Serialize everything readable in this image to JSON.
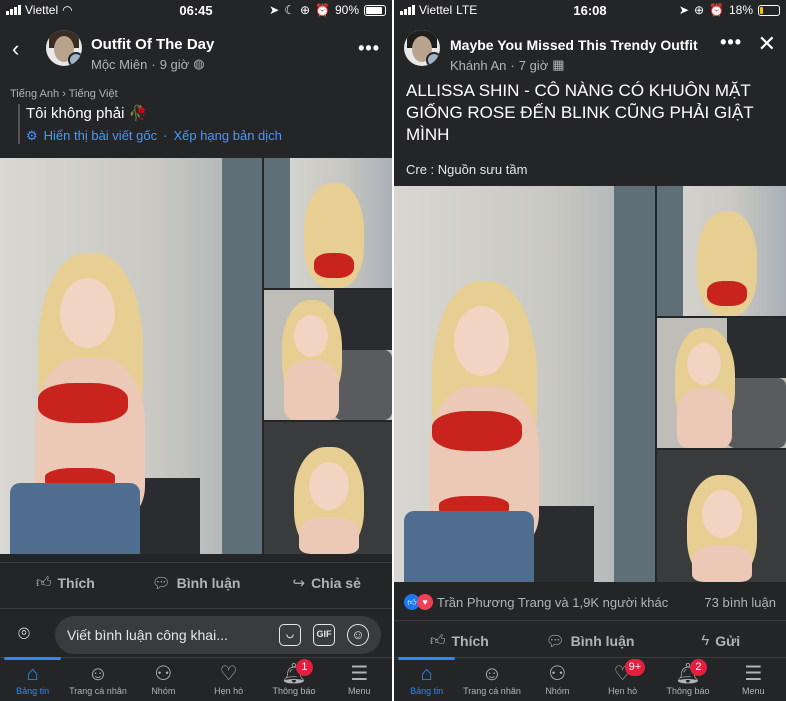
{
  "left": {
    "status": {
      "carrier": "Viettel",
      "time": "06:45",
      "battery": "90%",
      "battery_level": 0.9
    },
    "header": {
      "page_name": "Outfit Of The Day",
      "author": "Mộc Miên",
      "time": "9 giờ"
    },
    "translation": {
      "from": "Tiếng Anh",
      "arrow": "›",
      "to": "Tiếng Việt",
      "text": "Tôi không phải 🥀",
      "show_original": "Hiển thị bài viết gốc",
      "separator": "·",
      "rate": "Xếp hạng bản dịch"
    },
    "actions": {
      "like": "Thích",
      "comment": "Bình luận",
      "share": "Chia sẻ"
    },
    "comment_bar": {
      "placeholder": "Viết bình luận công khai...",
      "gif": "GIF"
    },
    "tabs": [
      {
        "label": "Bảng tin",
        "icon": "home-icon"
      },
      {
        "label": "Trang cá nhân",
        "icon": "profile-icon"
      },
      {
        "label": "Nhóm",
        "icon": "groups-icon"
      },
      {
        "label": "Hẹn hò",
        "icon": "dating-heart-icon"
      },
      {
        "label": "Thông báo",
        "icon": "bell-icon",
        "badge": "1"
      },
      {
        "label": "Menu",
        "icon": "menu-icon"
      }
    ]
  },
  "right": {
    "status": {
      "carrier": "Viettel",
      "network": "LTE",
      "time": "16:08",
      "battery": "18%",
      "battery_level": 0.18
    },
    "header": {
      "page_name": "Maybe You Missed This Trendy Outfit",
      "author": "Khánh An",
      "time": "7 giờ"
    },
    "post": {
      "headline": "ALLISSA SHIN - CÔ NÀNG CÓ KHUÔN MẶT GIỐNG ROSE ĐẾN BLINK CŨNG PHẢI GIẬT MÌNH",
      "source": "Cre : Nguồn sưu tầm"
    },
    "reactions": {
      "summary": "Trần Phương Trang và 1,9K người khác",
      "comments": "73 bình luận"
    },
    "actions": {
      "like": "Thích",
      "comment": "Bình luận",
      "send": "Gửi"
    },
    "tabs": [
      {
        "label": "Bảng tin",
        "icon": "home-icon"
      },
      {
        "label": "Trang cá nhân",
        "icon": "profile-icon"
      },
      {
        "label": "Nhóm",
        "icon": "groups-icon"
      },
      {
        "label": "Hẹn hò",
        "icon": "dating-heart-icon",
        "badge": "9+"
      },
      {
        "label": "Thông báo",
        "icon": "bell-icon",
        "badge": "2"
      },
      {
        "label": "Menu",
        "icon": "menu-icon"
      }
    ]
  },
  "colors": {
    "background": "#242526",
    "accent": "#2d88ff",
    "link": "#4599ff",
    "badge": "#e41e3f",
    "like_blue": "#1877f2",
    "love_red": "#f33e58"
  }
}
